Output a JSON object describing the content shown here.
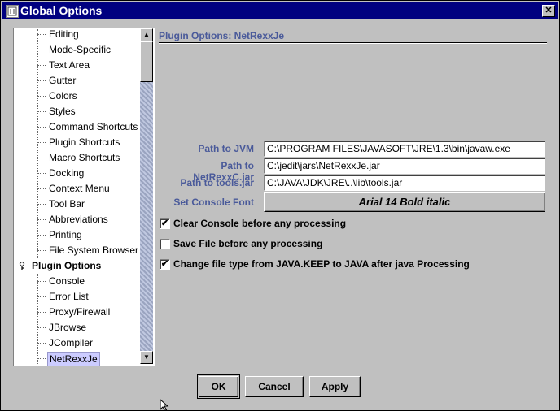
{
  "window": {
    "title": "Global Options",
    "close_glyph": "✕"
  },
  "tree": {
    "items": [
      {
        "label": "Editing"
      },
      {
        "label": "Mode-Specific"
      },
      {
        "label": "Text Area"
      },
      {
        "label": "Gutter"
      },
      {
        "label": "Colors"
      },
      {
        "label": "Styles"
      },
      {
        "label": "Command Shortcuts"
      },
      {
        "label": "Plugin Shortcuts"
      },
      {
        "label": "Macro Shortcuts"
      },
      {
        "label": "Docking"
      },
      {
        "label": "Context Menu"
      },
      {
        "label": "Tool Bar"
      },
      {
        "label": "Abbreviations"
      },
      {
        "label": "Printing"
      },
      {
        "label": "File System Browser"
      }
    ],
    "group": {
      "label": "Plugin Options",
      "icon": "key-icon"
    },
    "plugin_items": [
      {
        "label": "Console"
      },
      {
        "label": "Error List"
      },
      {
        "label": "Proxy/Firewall"
      },
      {
        "label": "JBrowse"
      },
      {
        "label": "JCompiler"
      },
      {
        "label": "NetRexxJe",
        "selected": true
      }
    ]
  },
  "panel": {
    "title": "Plugin Options: NetRexxJe",
    "fields": {
      "jvm_label": "Path to JVM",
      "jvm_value": "C:\\PROGRAM FILES\\JAVASOFT\\JRE\\1.3\\bin\\javaw.exe",
      "netrexxc_label": "Path to NetRexxC.jar",
      "netrexxc_value": "C:\\jedit\\jars\\NetRexxJe.jar",
      "tools_label": "Path to tools.jar",
      "tools_value": "C:\\JAVA\\JDK\\JRE\\..\\lib\\tools.jar",
      "font_label": "Set Console Font",
      "font_value": "Arial 14 Bold italic"
    },
    "checkboxes": [
      {
        "label": "Clear Console before any processing",
        "checked": true,
        "mark": "✔"
      },
      {
        "label": "Save File before any processing",
        "checked": false,
        "mark": ""
      },
      {
        "label": "Change file type from JAVA.KEEP to JAVA after java Processing",
        "checked": true,
        "mark": "✔"
      }
    ]
  },
  "buttons": {
    "ok": "OK",
    "cancel": "Cancel",
    "apply": "Apply"
  },
  "colors": {
    "titlebar": "#000080",
    "label_blue": "#4a5a9a",
    "selection": "#ccccff"
  }
}
